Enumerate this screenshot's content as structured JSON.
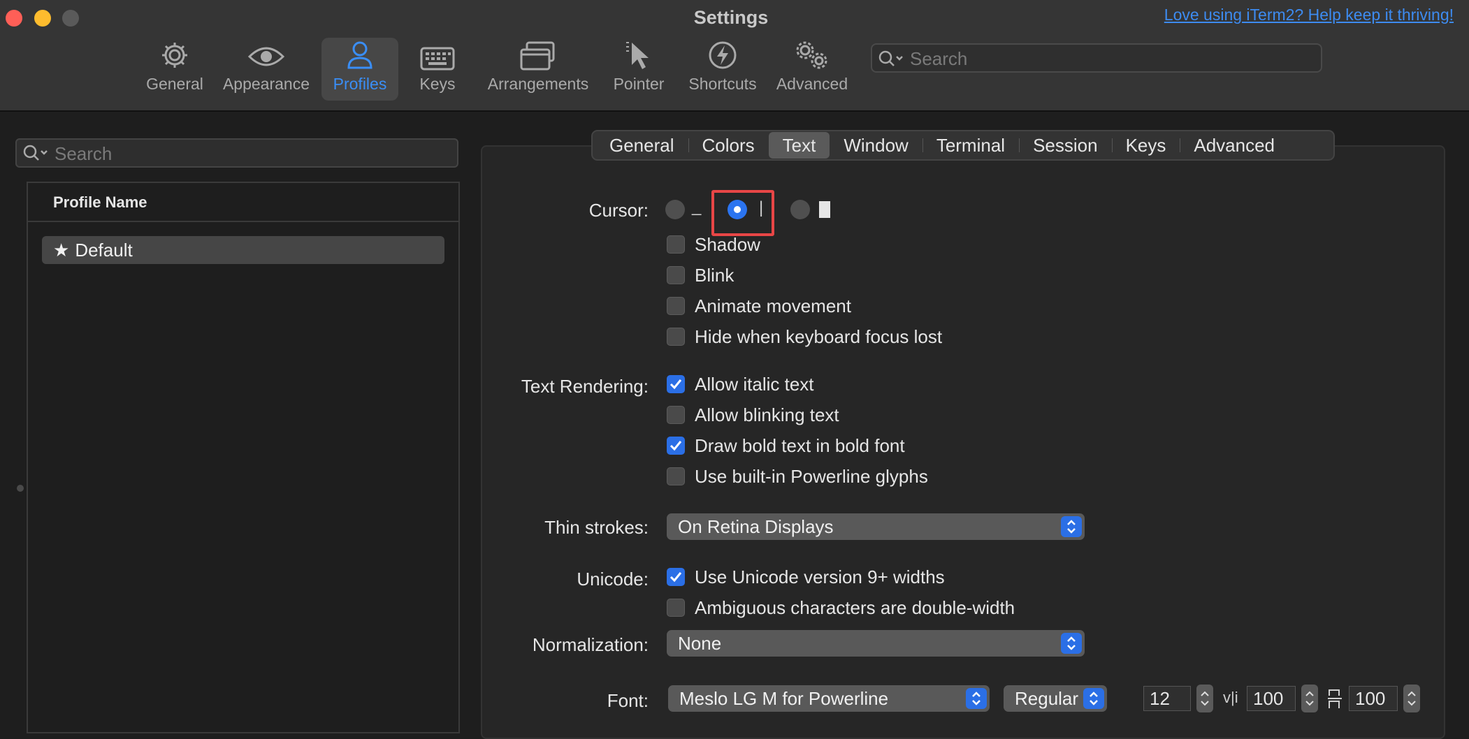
{
  "window": {
    "title": "Settings",
    "donate_link": "Love using iTerm2? Help keep it thriving!"
  },
  "toolbar": {
    "items": [
      {
        "label": "General",
        "icon": "gear-icon"
      },
      {
        "label": "Appearance",
        "icon": "eye-icon"
      },
      {
        "label": "Profiles",
        "icon": "person-icon",
        "active": true
      },
      {
        "label": "Keys",
        "icon": "keyboard-icon"
      },
      {
        "label": "Arrangements",
        "icon": "windows-icon"
      },
      {
        "label": "Pointer",
        "icon": "pointer-icon"
      },
      {
        "label": "Shortcuts",
        "icon": "bolt-icon"
      },
      {
        "label": "Advanced",
        "icon": "gears-icon"
      }
    ],
    "search_placeholder": "Search"
  },
  "sidebar": {
    "search_placeholder": "Search",
    "column_header": "Profile Name",
    "profiles": [
      {
        "name": "Default",
        "default": true
      }
    ]
  },
  "tabs": [
    "General",
    "Colors",
    "Text",
    "Window",
    "Terminal",
    "Session",
    "Keys",
    "Advanced"
  ],
  "active_tab": "Text",
  "cursor": {
    "label": "Cursor:",
    "options": [
      "underline",
      "vertical-bar",
      "box"
    ],
    "selected": "vertical-bar",
    "glyphs": {
      "underline": "_",
      "bar": "|"
    },
    "checks": [
      {
        "label": "Shadow",
        "checked": false
      },
      {
        "label": "Blink",
        "checked": false
      },
      {
        "label": "Animate movement",
        "checked": false
      },
      {
        "label": "Hide when keyboard focus lost",
        "checked": false
      }
    ]
  },
  "text_rendering": {
    "label": "Text Rendering:",
    "checks": [
      {
        "label": "Allow italic text",
        "checked": true
      },
      {
        "label": "Allow blinking text",
        "checked": false
      },
      {
        "label": "Draw bold text in bold font",
        "checked": true
      },
      {
        "label": "Use built-in Powerline glyphs",
        "checked": false
      }
    ]
  },
  "thin_strokes": {
    "label": "Thin strokes:",
    "value": "On Retina Displays"
  },
  "unicode": {
    "label": "Unicode:",
    "checks": [
      {
        "label": "Use Unicode version 9+ widths",
        "checked": true
      },
      {
        "label": "Ambiguous characters are double-width",
        "checked": false
      }
    ]
  },
  "normalization": {
    "label": "Normalization:",
    "value": "None"
  },
  "font": {
    "label": "Font:",
    "family": "Meslo LG M for Powerline",
    "weight": "Regular",
    "size": "12",
    "h_spacing_glyph": "v|i",
    "h_spacing": "100",
    "v_spacing": "100"
  },
  "colors": {
    "accent": "#2b6fe6",
    "highlight": "#e84646",
    "link": "#3d8bf0"
  }
}
